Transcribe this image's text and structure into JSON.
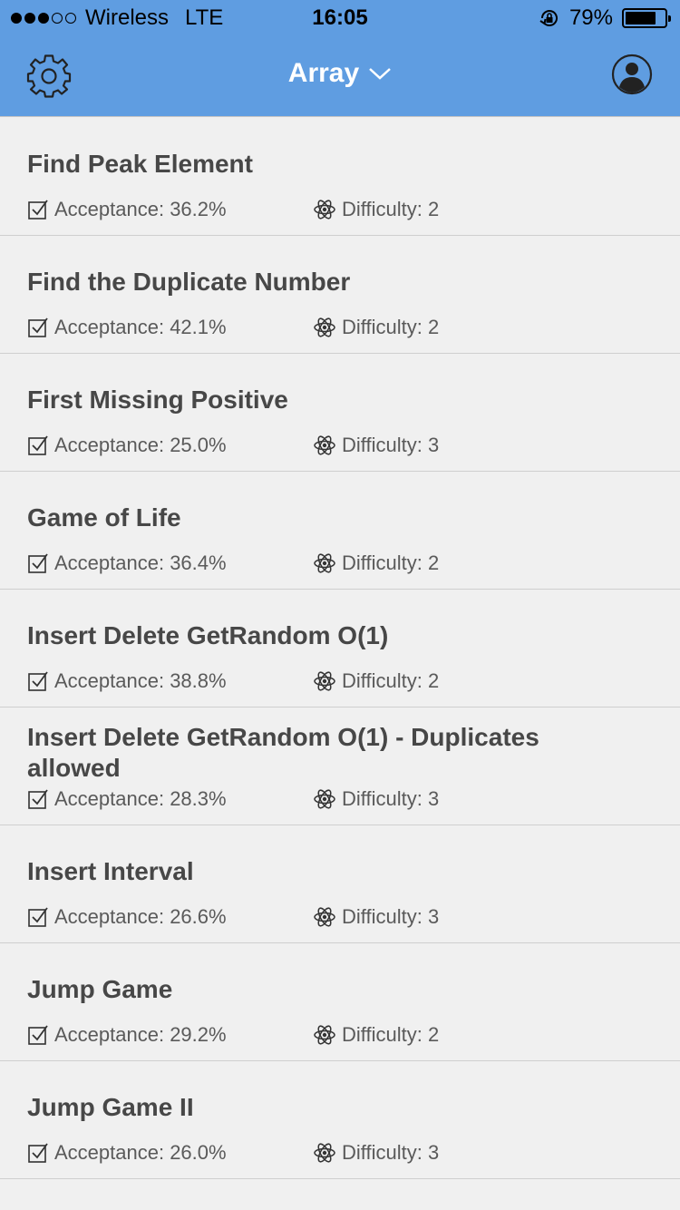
{
  "status_bar": {
    "carrier": "Wireless",
    "network": "LTE",
    "time": "16:05",
    "battery": "79%",
    "battery_level": 0.79
  },
  "nav": {
    "title": "Array"
  },
  "problems": [
    {
      "title": "Find Peak Element",
      "acceptance": "Acceptance: 36.2%",
      "difficulty": "Difficulty: 2"
    },
    {
      "title": "Find the Duplicate Number",
      "acceptance": "Acceptance: 42.1%",
      "difficulty": "Difficulty: 2"
    },
    {
      "title": "First Missing Positive",
      "acceptance": "Acceptance: 25.0%",
      "difficulty": "Difficulty: 3"
    },
    {
      "title": "Game of Life",
      "acceptance": "Acceptance: 36.4%",
      "difficulty": "Difficulty: 2"
    },
    {
      "title": "Insert Delete GetRandom O(1)",
      "acceptance": "Acceptance: 38.8%",
      "difficulty": "Difficulty: 2"
    },
    {
      "title": "Insert Delete GetRandom O(1) - Duplicates allowed",
      "acceptance": "Acceptance: 28.3%",
      "difficulty": "Difficulty: 3"
    },
    {
      "title": "Insert Interval",
      "acceptance": "Acceptance: 26.6%",
      "difficulty": "Difficulty: 3"
    },
    {
      "title": "Jump Game",
      "acceptance": "Acceptance: 29.2%",
      "difficulty": "Difficulty: 2"
    },
    {
      "title": "Jump Game II",
      "acceptance": "Acceptance: 26.0%",
      "difficulty": "Difficulty: 3"
    }
  ],
  "colors": {
    "header": "#5f9de1",
    "background": "#f0f0f0",
    "title_text": "#474747",
    "meta_text": "#5a5a5a"
  },
  "icons": {
    "settings": "gear-icon",
    "title_dropdown": "chevron-down-icon",
    "profile": "user-avatar-icon",
    "acceptance": "checkbox-icon",
    "difficulty": "atom-icon"
  }
}
